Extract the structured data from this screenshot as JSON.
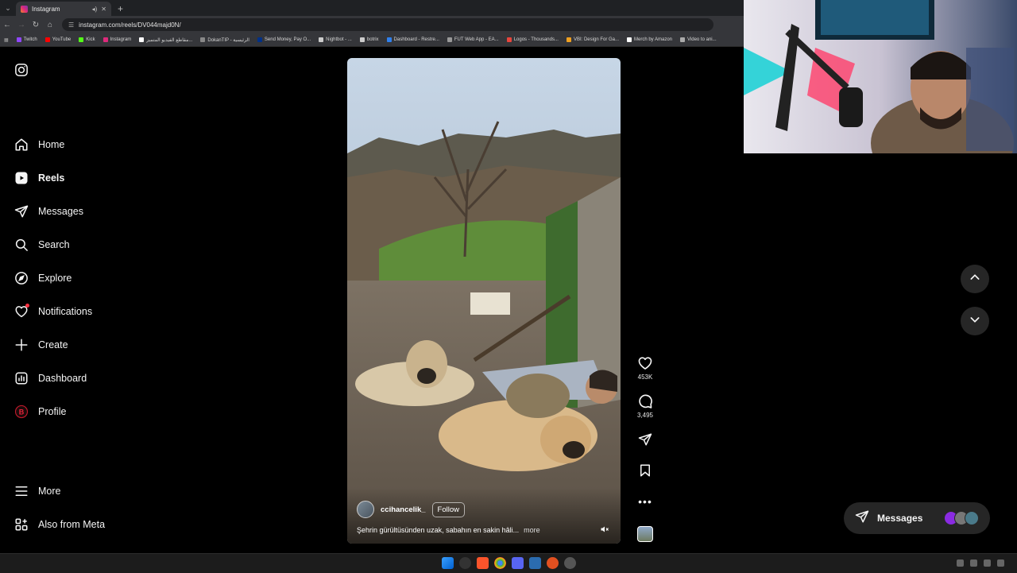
{
  "browser": {
    "tab_title": "Instagram",
    "url": "instagram.com/reels/DV044majd0N/",
    "bookmarks": [
      {
        "label": "Twitch",
        "color": "#9146ff"
      },
      {
        "label": "YouTube",
        "color": "#ff0000"
      },
      {
        "label": "Kick",
        "color": "#53fc18"
      },
      {
        "label": "Instagram",
        "color": "#dd2a7b"
      },
      {
        "label": "مقاطع الفيديو المتميز...",
        "color": "#ffffff"
      },
      {
        "label": "DokanTIP - الرئيسية",
        "color": "#888888"
      },
      {
        "label": "Send Money, Pay O...",
        "color": "#003087"
      },
      {
        "label": "Nightbot - ...",
        "color": "#cccccc"
      },
      {
        "label": "botrix",
        "color": "#cccccc"
      },
      {
        "label": "Dashboard - Restre...",
        "color": "#2f80ed"
      },
      {
        "label": "FUT Web App - EA...",
        "color": "#999999"
      },
      {
        "label": "Logos - Thousands...",
        "color": "#e8453c"
      },
      {
        "label": "VBI: Design For Ga...",
        "color": "#f0a020"
      },
      {
        "label": "Merch by Amazon",
        "color": "#ffffff"
      },
      {
        "label": "Video to ani...",
        "color": "#aaaaaa"
      }
    ]
  },
  "sidebar": {
    "items": [
      {
        "label": "Home",
        "icon": "home-icon"
      },
      {
        "label": "Reels",
        "icon": "reels-icon",
        "active": true
      },
      {
        "label": "Messages",
        "icon": "messages-icon"
      },
      {
        "label": "Search",
        "icon": "search-icon"
      },
      {
        "label": "Explore",
        "icon": "explore-icon"
      },
      {
        "label": "Notifications",
        "icon": "heart-icon",
        "badge": true
      },
      {
        "label": "Create",
        "icon": "plus-icon"
      },
      {
        "label": "Dashboard",
        "icon": "dashboard-icon"
      },
      {
        "label": "Profile",
        "icon": "profile-avatar"
      }
    ],
    "more_label": "More",
    "meta_label": "Also from Meta"
  },
  "reel": {
    "username": "ccihancelik_",
    "follow_label": "Follow",
    "caption": "Şehrin gürültüsünden uzak, sabahın en sakin hâli...",
    "more_label": "more",
    "likes": "453K",
    "comments": "3,495"
  },
  "messages_pill": {
    "label": "Messages"
  },
  "colors": {
    "background": "#000000",
    "notification_dot": "#ff3040",
    "pill_bg": "#262626"
  }
}
